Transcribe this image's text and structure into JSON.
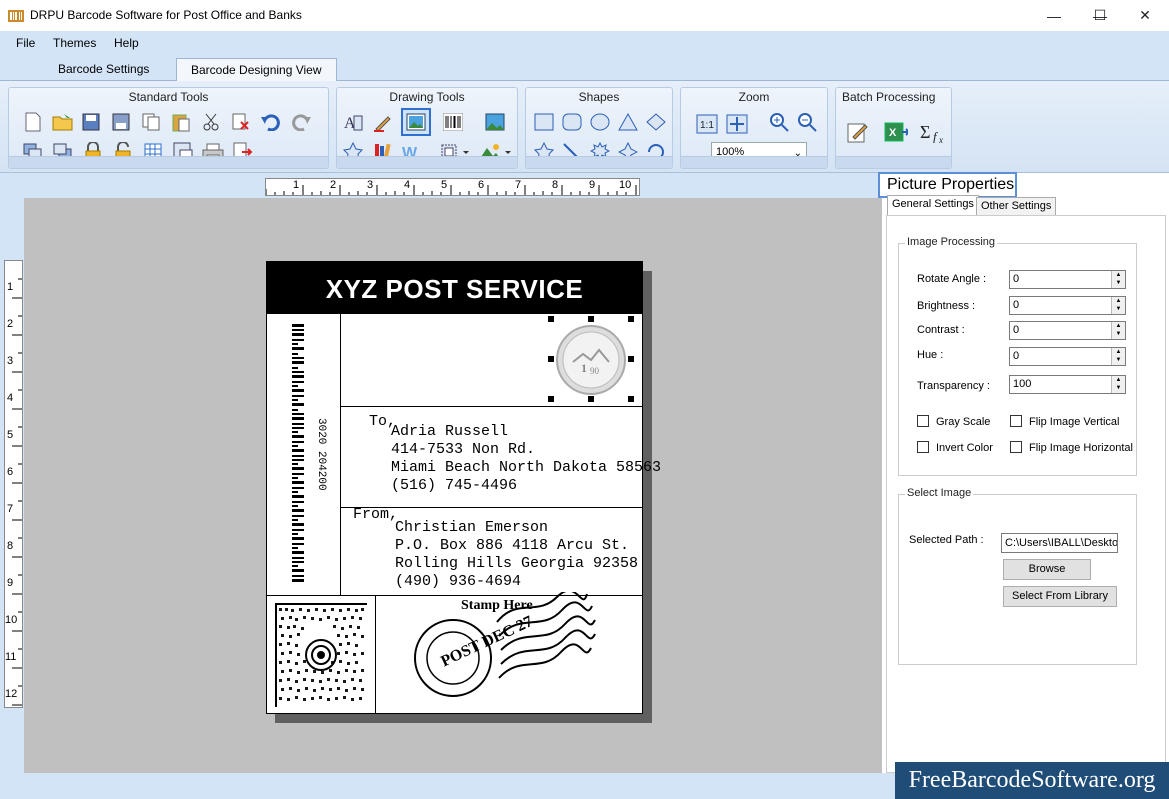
{
  "window": {
    "title": "DRPU Barcode Software for Post Office and Banks"
  },
  "menu": [
    "File",
    "Themes",
    "Help"
  ],
  "tabs": [
    {
      "label": "Barcode Settings",
      "active": false
    },
    {
      "label": "Barcode Designing View",
      "active": true
    }
  ],
  "ribbon": {
    "groups": {
      "standard": "Standard Tools",
      "drawing": "Drawing Tools",
      "shapes": "Shapes",
      "zoom": "Zoom",
      "batch": "Batch Processing"
    },
    "zoom_value": "100%"
  },
  "rulers": {
    "horizontal": [
      "1",
      "2",
      "3",
      "4",
      "5",
      "6",
      "7",
      "8",
      "9",
      "10"
    ],
    "vertical": [
      "1",
      "2",
      "3",
      "4",
      "5",
      "6",
      "7",
      "8",
      "9",
      "10",
      "11",
      "12"
    ]
  },
  "label": {
    "header": "XYZ POST SERVICE",
    "barcode_number": "3020 204200",
    "to_label": "To,",
    "to_lines": [
      "Adria Russell",
      "414-7533 Non Rd.",
      "Miami Beach North Dakota 58563",
      "(516) 745-4496"
    ],
    "from_label": "From,",
    "from_lines": [
      "Christian Emerson",
      "P.O. Box 886 4118 Arcu St.",
      "Rolling Hills Georgia 92358",
      "(490) 936-4694"
    ],
    "stamp_label": "Stamp Here",
    "postmark_text": "POST DEC 27"
  },
  "properties": {
    "title": "Picture Properties",
    "tabs": [
      "General Settings",
      "Other Settings"
    ],
    "image_processing": {
      "legend": "Image Processing",
      "fields": [
        {
          "label": "Rotate Angle :",
          "value": "0"
        },
        {
          "label": "Brightness     :",
          "value": "0"
        },
        {
          "label": "Contrast       :",
          "value": "0"
        },
        {
          "label": "Hue               :",
          "value": "0"
        },
        {
          "label": "Transparency :",
          "value": "100"
        }
      ],
      "checkboxes": [
        "Gray Scale",
        "Flip Image Vertical",
        "Invert Color",
        "Flip Image Horizontal"
      ]
    },
    "select_image": {
      "legend": "Select Image",
      "path_label": "Selected Path :",
      "path_value": "C:\\Users\\IBALL\\Deskto",
      "browse": "Browse",
      "library": "Select From Library"
    }
  },
  "watermark": "FreeBarcodeSoftware.org"
}
